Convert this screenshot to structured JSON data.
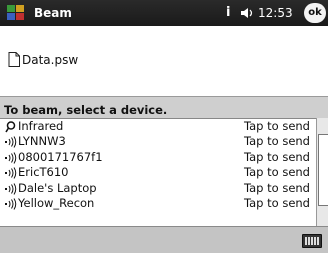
{
  "titlebar": {
    "title": "Beam",
    "status_indicator": "i",
    "volume_icon": "speaker-icon",
    "clock": "12:53",
    "ok_label": "ok"
  },
  "file": {
    "name": "Data.psw",
    "icon": "document-icon"
  },
  "instruction": "To beam, select a device.",
  "devices": [
    {
      "name": "Infrared",
      "action": "Tap to send",
      "icon": "infrared-icon"
    },
    {
      "name": "LYNNW3",
      "action": "Tap to send",
      "icon": "bluetooth-icon"
    },
    {
      "name": "0800171767f1",
      "action": "Tap to send",
      "icon": "bluetooth-icon"
    },
    {
      "name": "EricT610",
      "action": "Tap to send",
      "icon": "bluetooth-icon"
    },
    {
      "name": "Dale's Laptop",
      "action": "Tap to send",
      "icon": "bluetooth-icon"
    },
    {
      "name": "Yellow_Recon",
      "action": "Tap to send",
      "icon": "bluetooth-icon"
    }
  ],
  "bottombar": {
    "keyboard_icon": "keyboard-icon"
  }
}
